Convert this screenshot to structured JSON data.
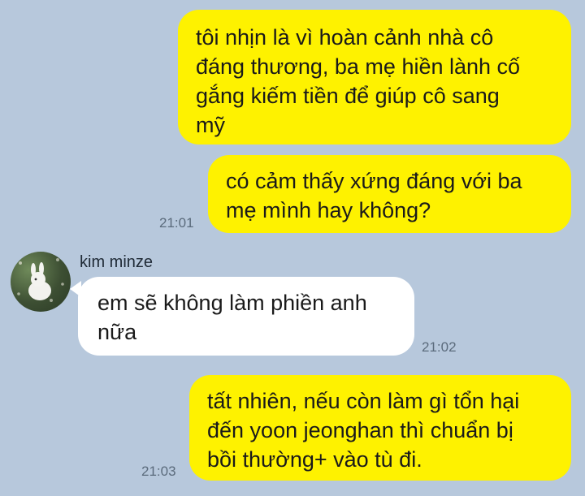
{
  "chat": {
    "messages": [
      {
        "id": "m1",
        "direction": "outgoing",
        "text": "tôi nhịn là vì hoàn cảnh nhà cô\nđáng thương, ba mẹ hiền lành cố\ngắng kiếm tiền để giúp cô sang\nmỹ",
        "time": ""
      },
      {
        "id": "m2",
        "direction": "outgoing",
        "text": "có cảm thấy xứng đáng với ba\nmẹ mình hay không?",
        "time": "21:01"
      },
      {
        "id": "m3",
        "direction": "incoming",
        "sender": "kim minze",
        "text": "em sẽ không làm phiền anh\nnữa",
        "time": "21:02"
      },
      {
        "id": "m4",
        "direction": "outgoing",
        "text": "tất nhiên, nếu còn làm gì tổn hại\nđến yoon jeonghan thì chuẩn bị\nbồi thường+ vào tù đi.",
        "time": "21:03"
      }
    ]
  },
  "colors": {
    "background": "#b7c8dc",
    "outgoing_bubble": "#fef200",
    "incoming_bubble": "#ffffff",
    "timestamp": "#5b6b7c"
  }
}
